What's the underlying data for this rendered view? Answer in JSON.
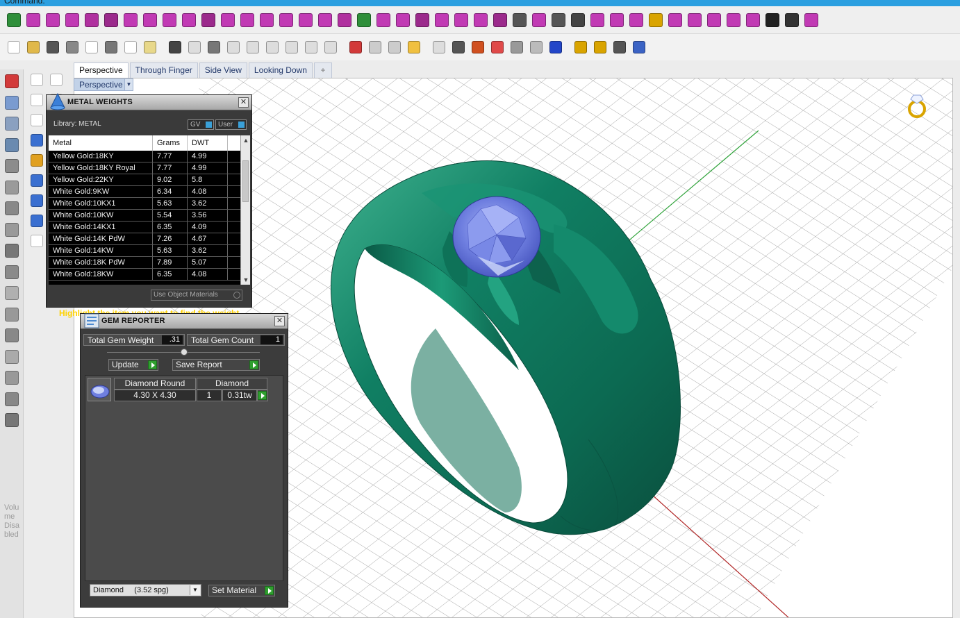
{
  "command_bar": {
    "label": "Command:"
  },
  "toolbar_top": {
    "icons": [
      {
        "name": "power-icon",
        "color": "#2f8f3a"
      },
      {
        "name": "cube-magenta-icon",
        "color": "#c13ab4"
      },
      {
        "name": "box-icon",
        "color": "#c13ab4"
      },
      {
        "name": "curve-tool-icon",
        "color": "#c13ab4"
      },
      {
        "name": "table-icon",
        "color": "#b0309f"
      },
      {
        "name": "shape-icon",
        "color": "#9b2a8c"
      },
      {
        "name": "pen-icon",
        "color": "#c13ab4"
      },
      {
        "name": "rotate-icon",
        "color": "#c13ab4"
      },
      {
        "name": "nodes-icon",
        "color": "#c13ab4"
      },
      {
        "name": "link-icon",
        "color": "#c13ab4"
      },
      {
        "name": "arch-icon",
        "color": "#9b2a8c"
      },
      {
        "name": "shield-icon",
        "color": "#c13ab4"
      },
      {
        "name": "prong-icon",
        "color": "#c13ab4"
      },
      {
        "name": "bail-icon",
        "color": "#c13ab4"
      },
      {
        "name": "panel-icon",
        "color": "#c13ab4"
      },
      {
        "name": "gem-icon",
        "color": "#c13ab4"
      },
      {
        "name": "stone-icon",
        "color": "#c13ab4"
      },
      {
        "name": "grid-magenta-icon",
        "color": "#b0309f"
      },
      {
        "name": "checkbox-icon",
        "color": "#2f8f3a"
      },
      {
        "name": "grid-icon",
        "color": "#c13ab4"
      },
      {
        "name": "layers-icon",
        "color": "#c13ab4"
      },
      {
        "name": "array-icon",
        "color": "#9b2a8c"
      },
      {
        "name": "setting-icon",
        "color": "#c13ab4"
      },
      {
        "name": "wave-icon",
        "color": "#c13ab4"
      },
      {
        "name": "chain-icon",
        "color": "#c13ab4"
      },
      {
        "name": "band-icon",
        "color": "#9b2a8c"
      },
      {
        "name": "dots-grid-icon",
        "color": "#555555"
      },
      {
        "name": "pave-icon",
        "color": "#c13ab4"
      },
      {
        "name": "cluster-icon",
        "color": "#555555"
      },
      {
        "name": "split-icon",
        "color": "#444444"
      },
      {
        "name": "branch-icon",
        "color": "#c13ab4"
      },
      {
        "name": "diamond-shape-icon",
        "color": "#c13ab4"
      },
      {
        "name": "target-icon",
        "color": "#c13ab4"
      },
      {
        "name": "star-icon",
        "color": "#d9a400"
      },
      {
        "name": "flower-icon",
        "color": "#c13ab4"
      },
      {
        "name": "comb-icon",
        "color": "#c13ab4"
      },
      {
        "name": "book-icon",
        "color": "#c13ab4"
      },
      {
        "name": "tile-icon",
        "color": "#c13ab4"
      },
      {
        "name": "tile-grid-icon",
        "color": "#c13ab4"
      },
      {
        "name": "cross-icon",
        "color": "#222222"
      },
      {
        "name": "cube-dark-icon",
        "color": "#333333"
      },
      {
        "name": "gear-magenta-icon",
        "color": "#c13ab4"
      }
    ]
  },
  "toolbar_second": {
    "icons": [
      {
        "name": "new-file-icon",
        "color": "#ffffff"
      },
      {
        "name": "open-folder-icon",
        "color": "#e0b84a"
      },
      {
        "name": "save-icon",
        "color": "#555555"
      },
      {
        "name": "print-icon",
        "color": "#888888"
      },
      {
        "name": "properties-icon",
        "color": "#ffffff"
      },
      {
        "name": "cut-icon",
        "color": "#777777"
      },
      {
        "name": "copy-icon",
        "color": "#ffffff"
      },
      {
        "name": "paste-icon",
        "color": "#e8d88a"
      },
      {
        "name": "undo-icon",
        "color": "#444444"
      },
      {
        "name": "pan-hand-icon",
        "color": "#dddddd"
      },
      {
        "name": "move-icon",
        "color": "#777777"
      },
      {
        "name": "zoom-icon",
        "color": "#dddddd"
      },
      {
        "name": "zoom-window-icon",
        "color": "#dddddd"
      },
      {
        "name": "zoom-extents-icon",
        "color": "#dddddd"
      },
      {
        "name": "zoom-selected-icon",
        "color": "#dddddd"
      },
      {
        "name": "rotate-view-icon",
        "color": "#dddddd"
      },
      {
        "name": "four-viewports-icon",
        "color": "#dddddd"
      },
      {
        "name": "car-icon",
        "color": "#d23a3a"
      },
      {
        "name": "camera-icon",
        "color": "#cccccc"
      },
      {
        "name": "osnap-icon",
        "color": "#cccccc"
      },
      {
        "name": "points-icon",
        "color": "#f0c040"
      },
      {
        "name": "light-bulb-icon",
        "color": "#dddddd"
      },
      {
        "name": "lock-icon",
        "color": "#555555"
      },
      {
        "name": "material-icon",
        "color": "#d05020"
      },
      {
        "name": "color-wheel-icon",
        "color": "#e04a4a"
      },
      {
        "name": "shade-sphere-icon",
        "color": "#999999"
      },
      {
        "name": "render-sphere-icon",
        "color": "#bbbbbb"
      },
      {
        "name": "blue-sphere-icon",
        "color": "#2346c8"
      },
      {
        "name": "pen-tool-icon",
        "color": "#d9a400"
      },
      {
        "name": "gears-icon",
        "color": "#d9a400"
      },
      {
        "name": "dimension-icon",
        "color": "#555555"
      },
      {
        "name": "help-icon",
        "color": "#3b63c4"
      }
    ]
  },
  "viewport_tabs": [
    {
      "label": "Perspective",
      "active": true
    },
    {
      "label": "Through Finger",
      "active": false
    },
    {
      "label": "Side View",
      "active": false
    },
    {
      "label": "Looking Down",
      "active": false
    }
  ],
  "viewport": {
    "title": "Perspective",
    "add_tab_symbol": "+"
  },
  "left_panel_text": "Volume Disabled",
  "metal_weights": {
    "title": "METAL WEIGHTS",
    "library_label": "Library: METAL",
    "toggle_gv": "GV",
    "toggle_user": "User",
    "columns": [
      "Metal",
      "Grams",
      "DWT"
    ],
    "rows": [
      [
        "Yellow Gold:18KY",
        "7.77",
        "4.99"
      ],
      [
        "Yellow Gold:18KY Royal",
        "7.77",
        "4.99"
      ],
      [
        "Yellow Gold:22KY",
        "9.02",
        "5.8"
      ],
      [
        "White Gold:9KW",
        "6.34",
        "4.08"
      ],
      [
        "White Gold:10KX1",
        "5.63",
        "3.62"
      ],
      [
        "White Gold:10KW",
        "5.54",
        "3.56"
      ],
      [
        "White Gold:14KX1",
        "6.35",
        "4.09"
      ],
      [
        "White Gold:14K PdW",
        "7.26",
        "4.67"
      ],
      [
        "White Gold:14KW",
        "5.63",
        "3.62"
      ],
      [
        "White Gold:18K PdW",
        "7.89",
        "5.07"
      ],
      [
        "White Gold:18KW",
        "6.35",
        "4.08"
      ]
    ],
    "use_object_materials": "Use Object Materials",
    "hint": "Highlight the item you want to find the weight"
  },
  "gem_reporter": {
    "title": "GEM REPORTER",
    "total_weight_label": "Total Gem Weight",
    "total_weight_value": ".31",
    "total_count_label": "Total Gem Count",
    "total_count_value": "1",
    "update_label": "Update",
    "save_report_label": "Save Report",
    "gems": [
      {
        "shape": "Diamond Round",
        "material": "Diamond",
        "size": "4.30 X 4.30",
        "count": "1",
        "weight": "0.31tw"
      }
    ],
    "material_select": "Diamond     (3.52 spg)",
    "set_material_label": "Set Material"
  }
}
